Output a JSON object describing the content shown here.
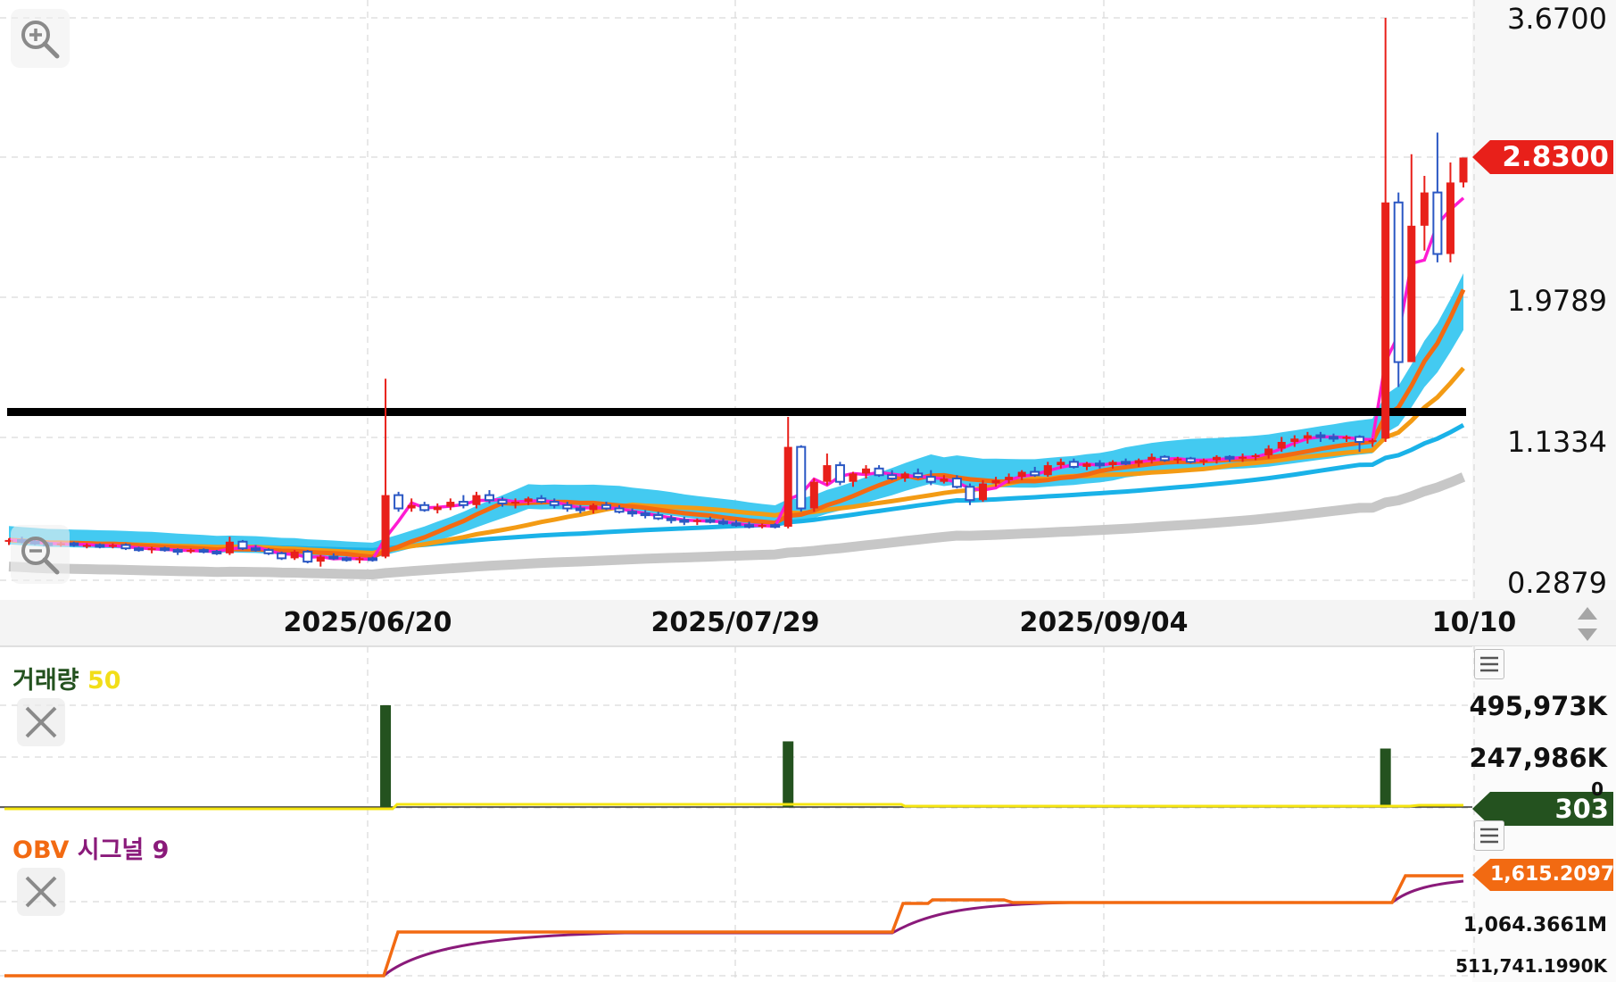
{
  "chart_data": {
    "type": "candlestick",
    "price_axis": {
      "ticks": [
        "3.6700",
        "1.9789",
        "1.1334",
        "0.2879"
      ],
      "ylim": [
        0.2879,
        3.67
      ],
      "current_price": "2.8300",
      "resistance_line": 1.3
    },
    "date_axis": {
      "labels": [
        "2025/06/20",
        "2025/07/29",
        "2025/09/04",
        "10/10"
      ]
    },
    "candles": [
      [
        0.52,
        0.54,
        0.5,
        0.53
      ],
      [
        0.53,
        0.55,
        0.51,
        0.52
      ],
      [
        0.52,
        0.53,
        0.5,
        0.51
      ],
      [
        0.51,
        0.52,
        0.49,
        0.5
      ],
      [
        0.5,
        0.52,
        0.49,
        0.51
      ],
      [
        0.51,
        0.52,
        0.49,
        0.5
      ],
      [
        0.5,
        0.51,
        0.48,
        0.5
      ],
      [
        0.5,
        0.51,
        0.48,
        0.49
      ],
      [
        0.49,
        0.51,
        0.48,
        0.5
      ],
      [
        0.5,
        0.51,
        0.47,
        0.48
      ],
      [
        0.48,
        0.49,
        0.46,
        0.47
      ],
      [
        0.47,
        0.49,
        0.45,
        0.48
      ],
      [
        0.48,
        0.49,
        0.46,
        0.47
      ],
      [
        0.47,
        0.48,
        0.44,
        0.46
      ],
      [
        0.46,
        0.48,
        0.45,
        0.47
      ],
      [
        0.47,
        0.48,
        0.45,
        0.46
      ],
      [
        0.46,
        0.47,
        0.44,
        0.45
      ],
      [
        0.45,
        0.55,
        0.44,
        0.52
      ],
      [
        0.52,
        0.53,
        0.47,
        0.48
      ],
      [
        0.48,
        0.5,
        0.46,
        0.47
      ],
      [
        0.47,
        0.48,
        0.44,
        0.45
      ],
      [
        0.45,
        0.46,
        0.41,
        0.42
      ],
      [
        0.42,
        0.47,
        0.41,
        0.46
      ],
      [
        0.46,
        0.47,
        0.39,
        0.4
      ],
      [
        0.4,
        0.44,
        0.37,
        0.43
      ],
      [
        0.43,
        0.45,
        0.41,
        0.42
      ],
      [
        0.42,
        0.43,
        0.4,
        0.41
      ],
      [
        0.41,
        0.43,
        0.39,
        0.42
      ],
      [
        0.42,
        0.43,
        0.4,
        0.41
      ],
      [
        0.43,
        1.5,
        0.42,
        0.8
      ],
      [
        0.8,
        0.82,
        0.7,
        0.72
      ],
      [
        0.72,
        0.78,
        0.7,
        0.74
      ],
      [
        0.74,
        0.76,
        0.7,
        0.71
      ],
      [
        0.71,
        0.75,
        0.69,
        0.73
      ],
      [
        0.73,
        0.78,
        0.71,
        0.76
      ],
      [
        0.76,
        0.8,
        0.72,
        0.74
      ],
      [
        0.74,
        0.82,
        0.72,
        0.8
      ],
      [
        0.8,
        0.83,
        0.75,
        0.77
      ],
      [
        0.77,
        0.79,
        0.73,
        0.75
      ],
      [
        0.75,
        0.78,
        0.72,
        0.76
      ],
      [
        0.76,
        0.79,
        0.74,
        0.78
      ],
      [
        0.78,
        0.8,
        0.75,
        0.76
      ],
      [
        0.76,
        0.78,
        0.72,
        0.74
      ],
      [
        0.74,
        0.76,
        0.7,
        0.72
      ],
      [
        0.72,
        0.74,
        0.69,
        0.71
      ],
      [
        0.71,
        0.75,
        0.69,
        0.74
      ],
      [
        0.74,
        0.76,
        0.71,
        0.72
      ],
      [
        0.72,
        0.74,
        0.69,
        0.7
      ],
      [
        0.7,
        0.72,
        0.67,
        0.69
      ],
      [
        0.69,
        0.71,
        0.66,
        0.68
      ],
      [
        0.68,
        0.7,
        0.65,
        0.66
      ],
      [
        0.66,
        0.68,
        0.63,
        0.65
      ],
      [
        0.65,
        0.67,
        0.62,
        0.64
      ],
      [
        0.64,
        0.66,
        0.62,
        0.65
      ],
      [
        0.65,
        0.67,
        0.63,
        0.64
      ],
      [
        0.64,
        0.66,
        0.62,
        0.63
      ],
      [
        0.63,
        0.65,
        0.61,
        0.62
      ],
      [
        0.62,
        0.64,
        0.6,
        0.61
      ],
      [
        0.61,
        0.63,
        0.6,
        0.62
      ],
      [
        0.62,
        0.63,
        0.6,
        0.61
      ],
      [
        0.61,
        1.27,
        0.6,
        1.09
      ],
      [
        1.09,
        1.1,
        0.7,
        0.72
      ],
      [
        0.72,
        0.9,
        0.7,
        0.88
      ],
      [
        0.88,
        1.05,
        0.86,
        0.98
      ],
      [
        0.98,
        1.0,
        0.86,
        0.88
      ],
      [
        0.88,
        0.94,
        0.85,
        0.93
      ],
      [
        0.93,
        0.98,
        0.9,
        0.96
      ],
      [
        0.96,
        0.98,
        0.91,
        0.92
      ],
      [
        0.92,
        0.95,
        0.89,
        0.9
      ],
      [
        0.9,
        0.94,
        0.88,
        0.93
      ],
      [
        0.93,
        0.96,
        0.9,
        0.91
      ],
      [
        0.91,
        0.95,
        0.86,
        0.88
      ],
      [
        0.88,
        0.92,
        0.87,
        0.9
      ],
      [
        0.9,
        0.92,
        0.84,
        0.85
      ],
      [
        0.85,
        0.87,
        0.74,
        0.77
      ],
      [
        0.77,
        0.89,
        0.76,
        0.87
      ],
      [
        0.87,
        0.91,
        0.85,
        0.89
      ],
      [
        0.89,
        0.93,
        0.87,
        0.91
      ],
      [
        0.91,
        0.95,
        0.89,
        0.94
      ],
      [
        0.94,
        0.97,
        0.91,
        0.92
      ],
      [
        0.92,
        1.0,
        0.91,
        0.98
      ],
      [
        0.98,
        1.02,
        0.96,
        1.0
      ],
      [
        1.0,
        1.02,
        0.96,
        0.97
      ],
      [
        0.97,
        1.0,
        0.95,
        0.99
      ],
      [
        0.99,
        1.01,
        0.96,
        0.98
      ],
      [
        0.98,
        1.01,
        0.96,
        1.0
      ],
      [
        1.0,
        1.02,
        0.98,
        0.99
      ],
      [
        0.99,
        1.02,
        0.97,
        1.01
      ],
      [
        1.01,
        1.05,
        0.99,
        1.03
      ],
      [
        1.03,
        1.04,
        1.0,
        1.01
      ],
      [
        1.01,
        1.03,
        0.99,
        1.02
      ],
      [
        1.02,
        1.03,
        0.99,
        1.0
      ],
      [
        1.0,
        1.02,
        0.98,
        1.01
      ],
      [
        1.01,
        1.04,
        0.99,
        1.03
      ],
      [
        1.03,
        1.04,
        1.0,
        1.02
      ],
      [
        1.02,
        1.05,
        1.0,
        1.03
      ],
      [
        1.03,
        1.05,
        1.01,
        1.04
      ],
      [
        1.04,
        1.1,
        1.02,
        1.08
      ],
      [
        1.08,
        1.15,
        1.06,
        1.12
      ],
      [
        1.12,
        1.16,
        1.09,
        1.14
      ],
      [
        1.14,
        1.18,
        1.11,
        1.16
      ],
      [
        1.16,
        1.18,
        1.12,
        1.15
      ],
      [
        1.15,
        1.17,
        1.12,
        1.14
      ],
      [
        1.14,
        1.16,
        1.12,
        1.15
      ],
      [
        1.15,
        1.16,
        1.06,
        1.12
      ],
      [
        1.12,
        1.14,
        1.09,
        1.13
      ],
      [
        1.14,
        3.67,
        1.12,
        2.56
      ],
      [
        2.56,
        2.62,
        1.45,
        1.6
      ],
      [
        1.6,
        2.85,
        1.6,
        2.42
      ],
      [
        2.42,
        2.72,
        2.27,
        2.62
      ],
      [
        2.62,
        2.98,
        2.2,
        2.25
      ],
      [
        2.25,
        2.8,
        2.2,
        2.68
      ],
      [
        2.68,
        2.83,
        2.65,
        2.83
      ]
    ],
    "volume": {
      "title": "거래량",
      "period": "50",
      "axis_ticks": [
        "495,973K",
        "247,986K",
        "0"
      ],
      "current": "303",
      "spikes": [
        {
          "index": 29,
          "value": 495973
        },
        {
          "index": 60,
          "value": 320000
        },
        {
          "index": 106,
          "value": 285000
        }
      ]
    },
    "obv": {
      "title": "OBV",
      "signal_title": "시그널 9",
      "axis_ticks": [
        "1,064.3661M",
        "511,741.1990K"
      ],
      "current": "1,615.2097M"
    }
  },
  "colors": {
    "up": "#e8201a",
    "down": "#2b58c4",
    "ma_short": "#ff1cd2",
    "ma_mid": "#f39b14",
    "ma_long": "#1ab2e8",
    "ma_trend": "#c7c7c7",
    "volume": "#24521f",
    "volume_ma": "#f5e50f",
    "obv": "#f26a12",
    "obv_signal": "#8a1a7a",
    "resistance": "#000000"
  },
  "icons": {
    "zoom_in": "zoom-in-icon",
    "zoom_out": "zoom-out-icon",
    "close": "close-icon",
    "menu": "menu-icon",
    "scroll": "scroll-arrows-icon"
  }
}
